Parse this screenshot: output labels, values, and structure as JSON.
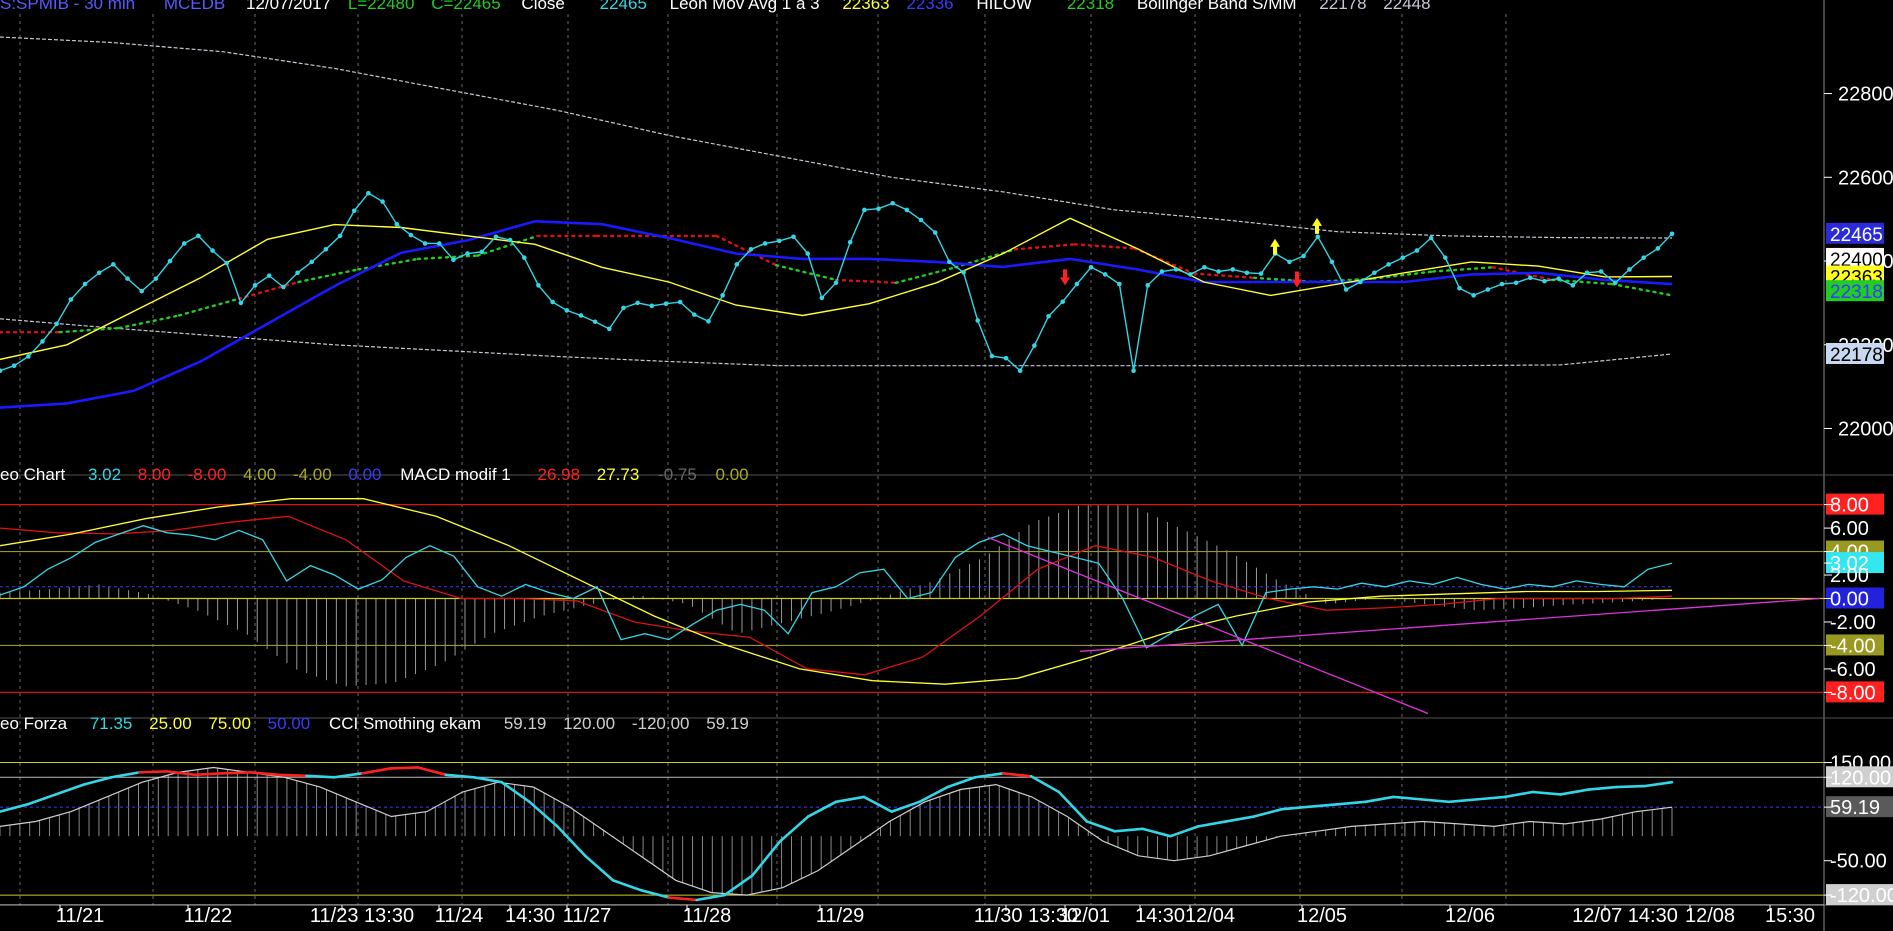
{
  "colors": {
    "background": "#000000",
    "price": "#33d6e6",
    "bollinger": "#c8c8d8",
    "mov1": "#ffff33",
    "mov2": "#1a1aff",
    "hilow_low": "#22cc22",
    "hilow_high": "#dd1111",
    "macd_fast": "#ffff33",
    "macd_slow": "#dd1111",
    "leo_chart": "#33d6e6",
    "histogram": "#9a9a9a",
    "trendline": "#dd33dd",
    "cci": "#33d6e6",
    "cci_hot": "#ff2020",
    "cci_smooth": "#cfcfcf",
    "level_line": "#cccc22",
    "grid": "#6a6a6a"
  },
  "header": {
    "price": [
      {
        "text": "S:SPMIB - 30 min",
        "color": "#5a5aff"
      },
      {
        "text": "MCEDB",
        "color": "#5a5aff"
      },
      {
        "text": "12/07/2017",
        "color": "#ffffff"
      },
      {
        "text": "L=22480",
        "color": "#22cc22"
      },
      {
        "text": "C=22465",
        "color": "#22cc22"
      },
      {
        "text": "Close",
        "color": "#ffffff"
      },
      {
        "text": "22465",
        "color": "#33d6e6"
      },
      {
        "text": "Leon Mov Avg 1 a 3",
        "color": "#ffffff"
      },
      {
        "text": "22363",
        "color": "#ffff33"
      },
      {
        "text": "22336",
        "color": "#3a3aff"
      },
      {
        "text": "HILOW",
        "color": "#ffffff"
      },
      {
        "text": "22318",
        "color": "#22cc22"
      },
      {
        "text": "Bollinger Band S/MM",
        "color": "#ffffff"
      },
      {
        "text": "22178",
        "color": "#c8c8d8"
      },
      {
        "text": "22448",
        "color": "#c8c8d8"
      }
    ],
    "macd": [
      {
        "text": "eo Chart",
        "color": "#ffffff"
      },
      {
        "text": "3.02",
        "color": "#33d6e6"
      },
      {
        "text": "8.00",
        "color": "#ff2020"
      },
      {
        "text": "-8.00",
        "color": "#ff2020"
      },
      {
        "text": "4.00",
        "color": "#aaaa22"
      },
      {
        "text": "-4.00",
        "color": "#aaaa22"
      },
      {
        "text": "0.00",
        "color": "#3a3aff"
      },
      {
        "text": "MACD modif 1",
        "color": "#ffffff"
      },
      {
        "text": "26.98",
        "color": "#ff2020"
      },
      {
        "text": "27.73",
        "color": "#ffff33"
      },
      {
        "text": "-0.75",
        "color": "#666666"
      },
      {
        "text": "0.00",
        "color": "#aaaa22"
      }
    ],
    "cci": [
      {
        "text": "eo Forza",
        "color": "#ffffff"
      },
      {
        "text": "71.35",
        "color": "#33d6e6"
      },
      {
        "text": "25.00",
        "color": "#ffff33"
      },
      {
        "text": "75.00",
        "color": "#ffff33"
      },
      {
        "text": "50.00",
        "color": "#3a3aff"
      },
      {
        "text": "CCI Smothing ekam",
        "color": "#ffffff"
      },
      {
        "text": "59.19",
        "color": "#cfcfcf"
      },
      {
        "text": "120.00",
        "color": "#cfcfcf"
      },
      {
        "text": "-120.00",
        "color": "#cfcfcf"
      },
      {
        "text": "59.19",
        "color": "#cfcfcf"
      }
    ]
  },
  "chart_data": [
    {
      "type": "line",
      "name": "price-panel",
      "ylim": [
        21920,
        22990
      ],
      "yticks": [
        "22800",
        "22600",
        "22400",
        "22200",
        "22000"
      ],
      "ytick_values": [
        22800,
        22600,
        22400,
        22200,
        22000
      ],
      "x_labels": [
        "11/21",
        "11/22",
        "11/23 13:30",
        "11/24",
        "14:30",
        "11/27",
        "11/28",
        "11/29",
        "11/30 13:30",
        "12/01",
        "14:30",
        "12/04",
        "12/05",
        "12/06",
        "12/07 14:30",
        "12/08",
        "15:30"
      ],
      "close": [
        22138,
        22150,
        22172,
        22208,
        22250,
        22308,
        22345,
        22372,
        22392,
        22358,
        22328,
        22358,
        22400,
        22442,
        22460,
        22425,
        22395,
        22300,
        22342,
        22365,
        22338,
        22372,
        22398,
        22428,
        22460,
        22520,
        22562,
        22542,
        22488,
        22462,
        22442,
        22442,
        22403,
        22418,
        22422,
        22458,
        22450,
        22408,
        22342,
        22302,
        22282,
        22270,
        22255,
        22238,
        22288,
        22300,
        22293,
        22298,
        22302,
        22272,
        22256,
        22318,
        22392,
        22428,
        22442,
        22448,
        22458,
        22418,
        22312,
        22348,
        22445,
        22522,
        22525,
        22538,
        22522,
        22498,
        22468,
        22398,
        22373,
        22258,
        22173,
        22168,
        22138,
        22198,
        22268,
        22303,
        22345,
        22385,
        22368,
        22345,
        22138,
        22342,
        22375,
        22380,
        22368,
        22385,
        22375,
        22380,
        22372,
        22370,
        22418,
        22398,
        22412,
        22458,
        22398,
        22332,
        22350,
        22372,
        22392,
        22408,
        22425,
        22455,
        22408,
        22335,
        22318,
        22332,
        22345,
        22348,
        22360,
        22352,
        22358,
        22342,
        22372,
        22375,
        22348,
        22380,
        22408,
        22430,
        22465
      ],
      "bb_upper": [
        22935,
        22922,
        22900,
        22860,
        22810,
        22760,
        22700,
        22650,
        22600,
        22565,
        22522,
        22498,
        22470,
        22460,
        22456,
        22455
      ],
      "bb_lower": [
        22262,
        22240,
        22220,
        22200,
        22186,
        22172,
        22160,
        22150,
        22150,
        22150,
        22150,
        22150,
        22150,
        22150,
        22152,
        22178
      ],
      "mov_avg_1": [
        22165,
        22200,
        22280,
        22360,
        22452,
        22487,
        22480,
        22460,
        22440,
        22385,
        22350,
        22295,
        22270,
        22298,
        22348,
        22418,
        22502,
        22430,
        22350,
        22318,
        22345,
        22372,
        22398,
        22388,
        22362,
        22363
      ],
      "mov_avg_2": [
        22050,
        22060,
        22090,
        22160,
        22250,
        22340,
        22420,
        22450,
        22495,
        22488,
        22455,
        22418,
        22405,
        22405,
        22398,
        22386,
        22405,
        22380,
        22350,
        22350,
        22350,
        22350,
        22368,
        22372,
        22355,
        22345
      ],
      "hilow": [
        22230,
        22230,
        22240,
        22270,
        22310,
        22350,
        22380,
        22405,
        22413,
        22460,
        22460,
        22460,
        22460,
        22390,
        22355,
        22348,
        22385,
        22428,
        22440,
        22430,
        22370,
        22360,
        22350,
        22358,
        22375,
        22385,
        22355,
        22345,
        22318
      ],
      "signals": [
        {
          "type": "down",
          "value": 22380
        },
        {
          "type": "up",
          "value": 22415
        },
        {
          "type": "down",
          "value": 22375
        },
        {
          "type": "up",
          "value": 22465
        }
      ],
      "last_value_tags": [
        {
          "text": "22465",
          "value": 22465
        },
        {
          "text": "22400",
          "value": 22405
        },
        {
          "text": "22363",
          "value": 22363
        },
        {
          "text": "22318",
          "value": 22328
        },
        {
          "text": "22178",
          "value": 22178
        }
      ]
    },
    {
      "type": "line",
      "name": "macd-panel",
      "ylim": [
        -9.5,
        9.5
      ],
      "yticks": [
        "8.00",
        "6.00",
        "4.00",
        "3.02",
        "2.00",
        "0.00",
        "-2.00",
        "-4.00",
        "-6.00",
        "-8.00"
      ],
      "ytick_values": [
        8,
        6,
        4,
        3.02,
        2,
        0,
        -2,
        -4,
        -6,
        -8
      ],
      "leo_chart": [
        0.3,
        1.0,
        2.5,
        3.5,
        4.8,
        5.5,
        6.2,
        5.6,
        5.4,
        5.0,
        5.8,
        5.0,
        1.5,
        2.8,
        2.0,
        0.8,
        1.6,
        3.5,
        4.5,
        3.6,
        1.0,
        0.2,
        1.2,
        0.5,
        0.0,
        1.0,
        -3.5,
        -3.0,
        -3.5,
        -2.2,
        -1.0,
        -0.5,
        -1.0,
        -3.0,
        0.5,
        1.0,
        2.2,
        2.5,
        0.0,
        0.5,
        3.5,
        4.8,
        5.5,
        4.5,
        4.0,
        3.5,
        3.0,
        0.0,
        -4.2,
        -3.0,
        -1.5,
        -0.5,
        -4.0,
        0.5,
        0.8,
        1.0,
        0.8,
        1.3,
        1.0,
        1.5,
        1.2,
        1.8,
        1.2,
        0.8,
        1.2,
        1.0,
        1.5,
        1.2,
        1.0,
        2.5,
        3.0
      ],
      "macd_fast": [
        4.5,
        5.5,
        6.8,
        7.8,
        8.5,
        8.5,
        7.0,
        4.5,
        1.5,
        -1.5,
        -4.0,
        -6.0,
        -7.0,
        -7.3,
        -6.8,
        -5.0,
        -3.0,
        -1.5,
        -0.3,
        0.2,
        0.4,
        0.6,
        0.6,
        0.7
      ],
      "macd_slow": [
        6.0,
        5.6,
        5.5,
        5.8,
        6.5,
        7.0,
        5.0,
        1.5,
        0.0,
        0.0,
        -0.2,
        -2.0,
        -2.8,
        -3.3,
        -6.0,
        -6.5,
        -5.0,
        -1.5,
        2.5,
        4.5,
        3.5,
        1.5,
        0.0,
        -1.0,
        -0.8,
        -0.5,
        0.0,
        0.0,
        0.0,
        0.2
      ],
      "histogram": [
        0.5,
        0.8,
        1.2,
        0.4,
        -1.0,
        -3.0,
        -6.0,
        -7.5,
        -7.2,
        -5.5,
        -3.0,
        -1.5,
        -0.5,
        0.3,
        -0.5,
        -3.0,
        -2.0,
        -1.0,
        0.2,
        1.5,
        3.5,
        6.5,
        8.0,
        8.0,
        6.0,
        4.0,
        1.5,
        -0.5,
        0.0,
        -0.5,
        -1.0,
        -0.8,
        -0.5,
        -0.3,
        0.0
      ],
      "levels": [
        8,
        4,
        0,
        -4,
        -8
      ]
    },
    {
      "type": "line",
      "name": "cci-panel",
      "ylim": [
        -130,
        200
      ],
      "yticks": [
        "150.00",
        "120.00",
        "59.19",
        "-50.00",
        "-120.00"
      ],
      "ytick_values": [
        150,
        120,
        59.19,
        -50,
        -120
      ],
      "cci": [
        50,
        65,
        85,
        105,
        120,
        130,
        132,
        125,
        128,
        130,
        125,
        123,
        120,
        128,
        138,
        140,
        125,
        120,
        110,
        70,
        20,
        -40,
        -90,
        -110,
        -125,
        -130,
        -120,
        -80,
        -10,
        40,
        70,
        80,
        50,
        70,
        100,
        120,
        128,
        122,
        90,
        30,
        10,
        15,
        0,
        20,
        30,
        40,
        55,
        60,
        65,
        70,
        80,
        75,
        70,
        75,
        80,
        90,
        85,
        95,
        100,
        102,
        110
      ],
      "cci_smooth": [
        20,
        30,
        50,
        80,
        110,
        130,
        140,
        130,
        120,
        100,
        70,
        40,
        50,
        90,
        110,
        100,
        60,
        10,
        -40,
        -90,
        -115,
        -120,
        -105,
        -70,
        -20,
        30,
        70,
        95,
        105,
        80,
        40,
        -10,
        -40,
        -50,
        -40,
        -20,
        0,
        10,
        20,
        25,
        30,
        25,
        20,
        30,
        25,
        35,
        50,
        59
      ],
      "levels": [
        150,
        120,
        59.19,
        -120,
        -140
      ]
    }
  ]
}
